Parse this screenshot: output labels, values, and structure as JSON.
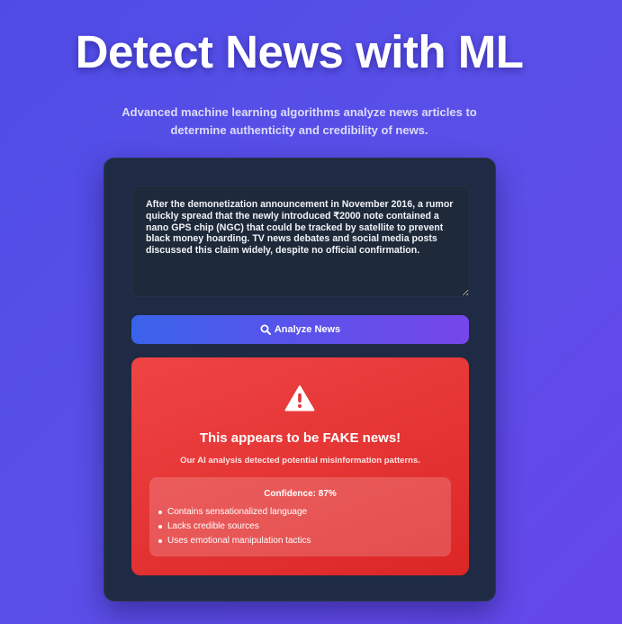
{
  "hero": {
    "title": "Detect News with ML",
    "subtitle": "Advanced machine learning algorithms analyze news articles to determine authenticity and credibility of news."
  },
  "form": {
    "input_value": "After the demonetization announcement in November 2016, a rumor quickly spread that the newly introduced ₹2000 note contained a nano GPS chip (NGC) that could be tracked by satellite to prevent black money hoarding. TV news debates and social media posts discussed this claim widely, despite no official confirmation.",
    "analyze_label": "Analyze News",
    "analyze_icon": "search-icon"
  },
  "result": {
    "icon": "warning-icon",
    "title": "This appears to be FAKE news!",
    "description": "Our AI analysis detected potential misinformation patterns.",
    "confidence_text": "Confidence: 87%",
    "reasons": [
      "Contains sensationalized language",
      "Lacks credible sources",
      "Uses emotional manipulation tactics"
    ]
  },
  "colors": {
    "background": "#5249e6",
    "card": "#1f2a44",
    "fake_result": "#e53535",
    "button_start": "#3a63ea",
    "button_end": "#7646ea"
  }
}
